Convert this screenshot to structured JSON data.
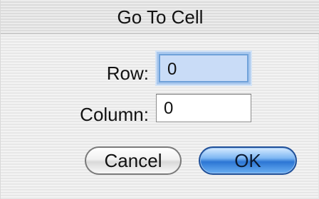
{
  "dialog": {
    "title": "Go To Cell",
    "row_label": "Row:",
    "row_value": "0",
    "column_label": "Column:",
    "column_value": "0",
    "cancel_label": "Cancel",
    "ok_label": "OK"
  }
}
